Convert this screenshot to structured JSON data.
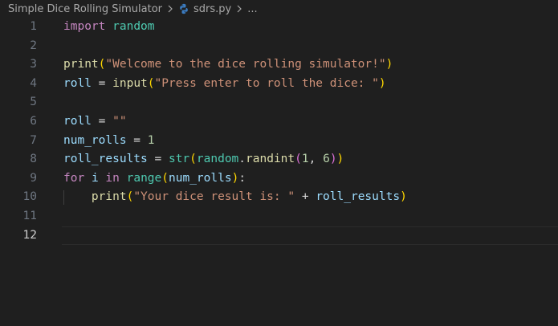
{
  "breadcrumb": {
    "folder": "Simple Dice Rolling Simulator",
    "file": "sdrs.py",
    "ellipsis": "..."
  },
  "lines": [
    {
      "n": "1",
      "tokens": [
        [
          "kw-ctrl",
          "import"
        ],
        [
          "op",
          " "
        ],
        [
          "mod",
          "random"
        ]
      ]
    },
    {
      "n": "2",
      "tokens": []
    },
    {
      "n": "3",
      "tokens": [
        [
          "fn",
          "print"
        ],
        [
          "br1",
          "("
        ],
        [
          "str",
          "\"Welcome to the dice rolling simulator!\""
        ],
        [
          "br1",
          ")"
        ]
      ]
    },
    {
      "n": "4",
      "tokens": [
        [
          "var",
          "roll"
        ],
        [
          "op",
          " = "
        ],
        [
          "fn",
          "input"
        ],
        [
          "br1",
          "("
        ],
        [
          "str",
          "\"Press enter to roll the dice: \""
        ],
        [
          "br1",
          ")"
        ]
      ]
    },
    {
      "n": "5",
      "tokens": []
    },
    {
      "n": "6",
      "tokens": [
        [
          "var",
          "roll"
        ],
        [
          "op",
          " = "
        ],
        [
          "str",
          "\"\""
        ]
      ]
    },
    {
      "n": "7",
      "tokens": [
        [
          "var",
          "num_rolls"
        ],
        [
          "op",
          " = "
        ],
        [
          "num",
          "1"
        ]
      ]
    },
    {
      "n": "8",
      "tokens": [
        [
          "var",
          "roll_results"
        ],
        [
          "op",
          " = "
        ],
        [
          "mod",
          "str"
        ],
        [
          "br1",
          "("
        ],
        [
          "mod",
          "random"
        ],
        [
          "op",
          "."
        ],
        [
          "fn",
          "randint"
        ],
        [
          "br2",
          "("
        ],
        [
          "num",
          "1"
        ],
        [
          "op",
          ", "
        ],
        [
          "num",
          "6"
        ],
        [
          "br2",
          ")"
        ],
        [
          "br1",
          ")"
        ]
      ]
    },
    {
      "n": "9",
      "tokens": [
        [
          "kw-ctrl",
          "for"
        ],
        [
          "op",
          " "
        ],
        [
          "var",
          "i"
        ],
        [
          "op",
          " "
        ],
        [
          "kw-ctrl",
          "in"
        ],
        [
          "op",
          " "
        ],
        [
          "mod",
          "range"
        ],
        [
          "br1",
          "("
        ],
        [
          "var",
          "num_rolls"
        ],
        [
          "br1",
          ")"
        ],
        [
          "op",
          ":"
        ]
      ]
    },
    {
      "n": "10",
      "indent": true,
      "tokens": [
        [
          "op",
          "    "
        ],
        [
          "fn",
          "print"
        ],
        [
          "br1",
          "("
        ],
        [
          "str",
          "\"Your dice result is: \""
        ],
        [
          "op",
          " + "
        ],
        [
          "var",
          "roll_results"
        ],
        [
          "br1",
          ")"
        ]
      ]
    },
    {
      "n": "11",
      "tokens": []
    },
    {
      "n": "12",
      "current": true,
      "tokens": []
    }
  ]
}
